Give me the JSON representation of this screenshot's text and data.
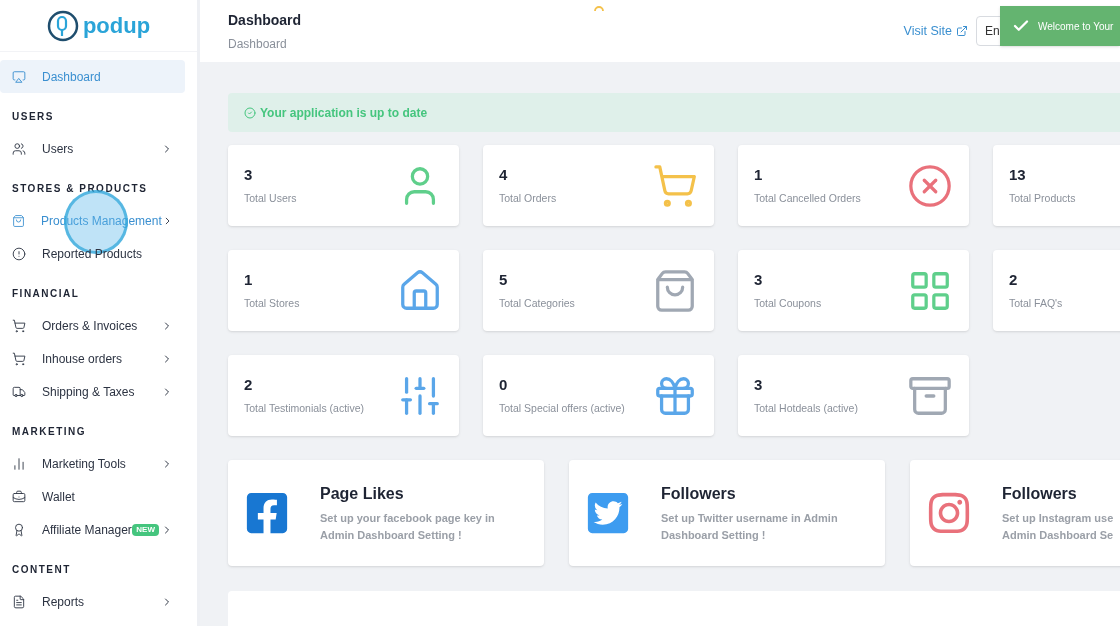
{
  "logo": {
    "text": "podup"
  },
  "sidebar": {
    "items": [
      {
        "kind": "item",
        "label": "Dashboard",
        "selected": true,
        "hovered": false,
        "submenu": false
      },
      {
        "kind": "heading",
        "label": "USERS"
      },
      {
        "kind": "item",
        "label": "Users",
        "selected": false,
        "hovered": false,
        "submenu": true
      },
      {
        "kind": "heading",
        "label": "STORES & PRODUCTS"
      },
      {
        "kind": "item",
        "label": "Products Management",
        "selected": false,
        "hovered": true,
        "submenu": true
      },
      {
        "kind": "item",
        "label": "Reported Products",
        "selected": false,
        "hovered": false,
        "submenu": false
      },
      {
        "kind": "heading",
        "label": "FINANCIAL"
      },
      {
        "kind": "item",
        "label": "Orders & Invoices",
        "selected": false,
        "hovered": false,
        "submenu": true
      },
      {
        "kind": "item",
        "label": "Inhouse orders",
        "selected": false,
        "hovered": false,
        "submenu": true
      },
      {
        "kind": "item",
        "label": "Shipping & Taxes",
        "selected": false,
        "hovered": false,
        "submenu": true
      },
      {
        "kind": "heading",
        "label": "MARKETING"
      },
      {
        "kind": "item",
        "label": "Marketing Tools",
        "selected": false,
        "hovered": false,
        "submenu": true
      },
      {
        "kind": "item",
        "label": "Wallet",
        "selected": false,
        "hovered": false,
        "submenu": false
      },
      {
        "kind": "item",
        "label": "Affiliate Manager",
        "badge": "NEW",
        "selected": false,
        "hovered": false,
        "submenu": true
      },
      {
        "kind": "heading",
        "label": "CONTENT"
      },
      {
        "kind": "item",
        "label": "Reports",
        "selected": false,
        "hovered": false,
        "submenu": true
      }
    ]
  },
  "header": {
    "title": "Dashboard",
    "breadcrumb": "Dashboard",
    "visit_site": "Visit Site",
    "language": "En"
  },
  "toast": {
    "message": "Welcome to Your"
  },
  "alert": {
    "message": "Your application is up to date"
  },
  "stats": [
    {
      "value": "3",
      "label": "Total Users"
    },
    {
      "value": "4",
      "label": "Total Orders"
    },
    {
      "value": "1",
      "label": "Total Cancelled Orders"
    },
    {
      "value": "13",
      "label": "Total Products"
    },
    {
      "value": "1",
      "label": "Total Stores"
    },
    {
      "value": "5",
      "label": "Total Categories"
    },
    {
      "value": "3",
      "label": "Total Coupons"
    },
    {
      "value": "2",
      "label": "Total FAQ's"
    },
    {
      "value": "2",
      "label": "Total Testimonials (active)"
    },
    {
      "value": "0",
      "label": "Total Special offers (active)"
    },
    {
      "value": "3",
      "label": "Total Hotdeals (active)"
    }
  ],
  "social": [
    {
      "title": "Page Likes",
      "lines": [
        "Set up your facebook page key in",
        "Admin Dashboard Setting !"
      ]
    },
    {
      "title": "Followers",
      "lines": [
        "Set up Twitter username in Admin",
        "Dashboard Setting !"
      ]
    },
    {
      "title": "Followers",
      "lines": [
        "Set up Instagram use",
        "Admin Dashboard Se"
      ]
    }
  ]
}
